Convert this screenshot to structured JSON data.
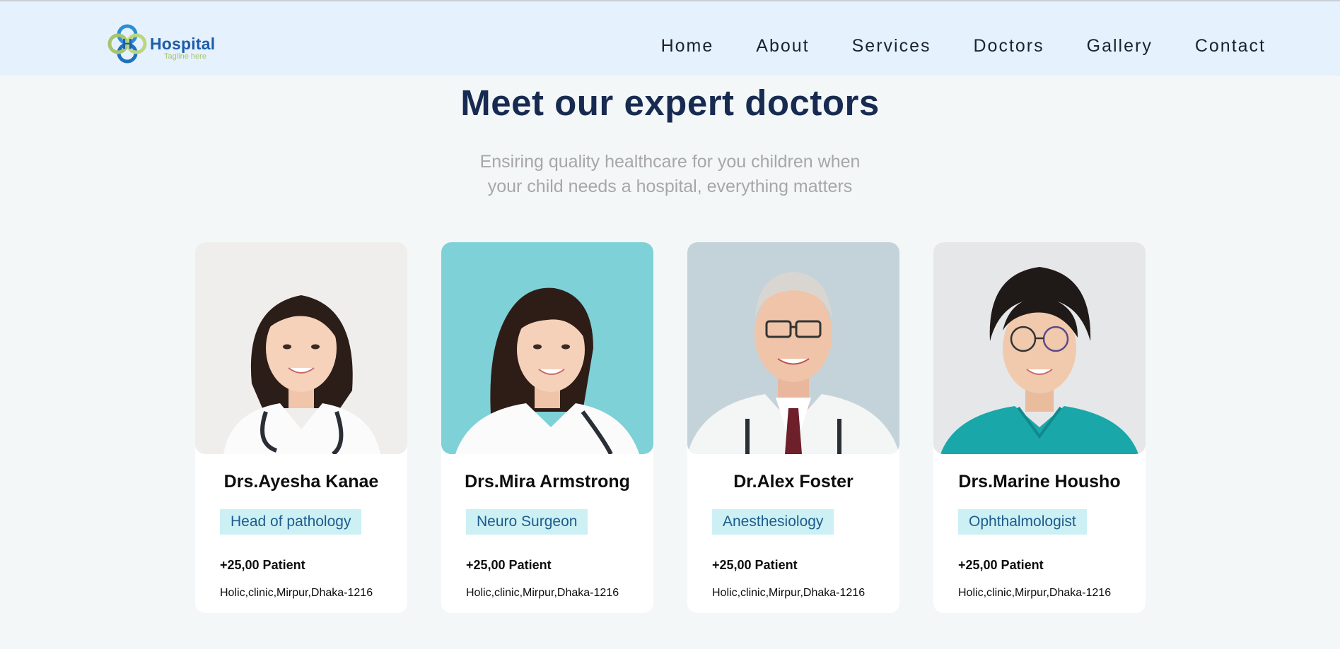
{
  "brand": {
    "name": "Hospital",
    "tagline": "Tagline here",
    "colors": {
      "primary": "#1d5da8",
      "accent": "#a6c56f",
      "nav_bg": "#e6f1fe"
    }
  },
  "nav": {
    "items": [
      {
        "label": "Home"
      },
      {
        "label": "About"
      },
      {
        "label": "Services"
      },
      {
        "label": "Doctors"
      },
      {
        "label": "Gallery"
      },
      {
        "label": "Contact"
      }
    ]
  },
  "section": {
    "title": "Meet our expert doctors",
    "subtitle_line1": "Ensiring quality healthcare for you children when",
    "subtitle_line2": "your child needs a hospital, everything matters"
  },
  "doctors": [
    {
      "name": "Drs.Ayesha Kanae",
      "role": "Head of pathology",
      "patients": "+25,00 Patient",
      "address": "Holic,clinic,Mirpur,Dhaka-1216",
      "photo_bg": "#efeeec"
    },
    {
      "name": "Drs.Mira Armstrong",
      "role": "Neuro Surgeon",
      "patients": "+25,00 Patient",
      "address": "Holic,clinic,Mirpur,Dhaka-1216",
      "photo_bg": "#7fd1d8"
    },
    {
      "name": "Dr.Alex Foster",
      "role": "Anesthesiology",
      "patients": "+25,00 Patient",
      "address": "Holic,clinic,Mirpur,Dhaka-1216",
      "photo_bg": "#c4d3da"
    },
    {
      "name": "Drs.Marine Housho",
      "role": "Ophthalmologist",
      "patients": "+25,00 Patient",
      "address": "Holic,clinic,Mirpur,Dhaka-1216",
      "photo_bg": "#e6e7e9"
    }
  ]
}
